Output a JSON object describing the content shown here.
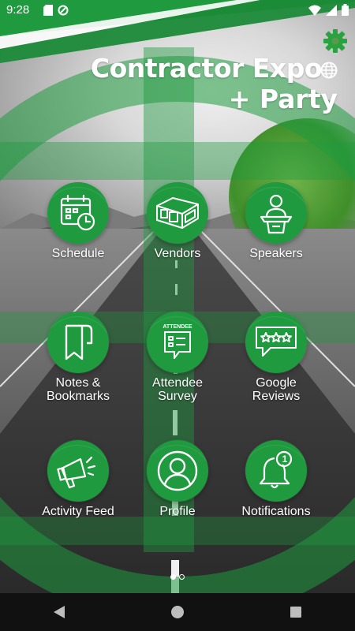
{
  "status_bar": {
    "time": "9:28"
  },
  "header": {
    "title_line1": "Contractor Expo",
    "title_line2": "+ Party"
  },
  "tiles": [
    {
      "label": "Schedule",
      "icon": "calendar-clock-icon"
    },
    {
      "label": "Vendors",
      "icon": "booth-icon"
    },
    {
      "label": "Speakers",
      "icon": "speaker-podium-icon"
    },
    {
      "label": "Notes &\nBookmarks",
      "icon": "bookmark-icon"
    },
    {
      "label": "Attendee\nSurvey",
      "icon": "survey-icon",
      "badge_text": "ATTENDEE"
    },
    {
      "label": "Google\nReviews",
      "icon": "stars-review-icon"
    },
    {
      "label": "Activity Feed",
      "icon": "megaphone-icon"
    },
    {
      "label": "Profile",
      "icon": "user-icon"
    },
    {
      "label": "Notifications",
      "icon": "bell-icon",
      "badge": "1"
    }
  ],
  "pager": {
    "pages": 2,
    "active": 0
  },
  "colors": {
    "accent_green": "#1f9a3f",
    "gear_green": "#2aa23f"
  }
}
